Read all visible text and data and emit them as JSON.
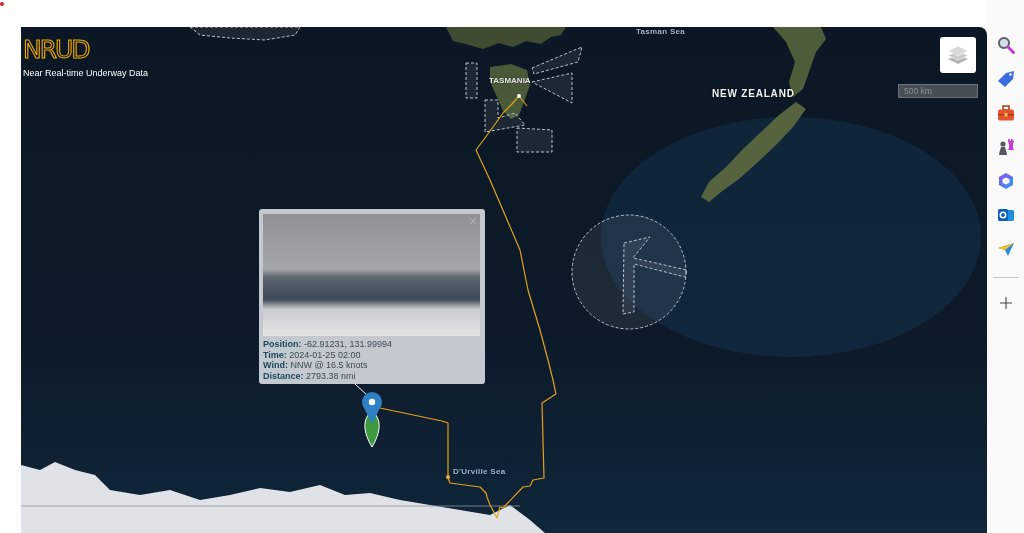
{
  "app": {
    "logo_text": "NRUD",
    "subtitle": "Near Real-time Underway Data"
  },
  "map": {
    "labels": [
      {
        "text": "Tasman Sea",
        "kind": "sea"
      },
      {
        "text": "TASMANIA",
        "kind": "region"
      },
      {
        "text": "NEW ZEALAND",
        "kind": "country"
      },
      {
        "text": "D'Urville Sea",
        "kind": "sea"
      }
    ],
    "scale": "500 km"
  },
  "popup": {
    "lines": [
      "**Position:** -62.91231, 131.99994",
      "**Time:** 2024-01-25 02:00",
      "**Wind:** NNW @ 16.5 knots",
      "**Distance:** 2793.38 nmi"
    ]
  }
}
